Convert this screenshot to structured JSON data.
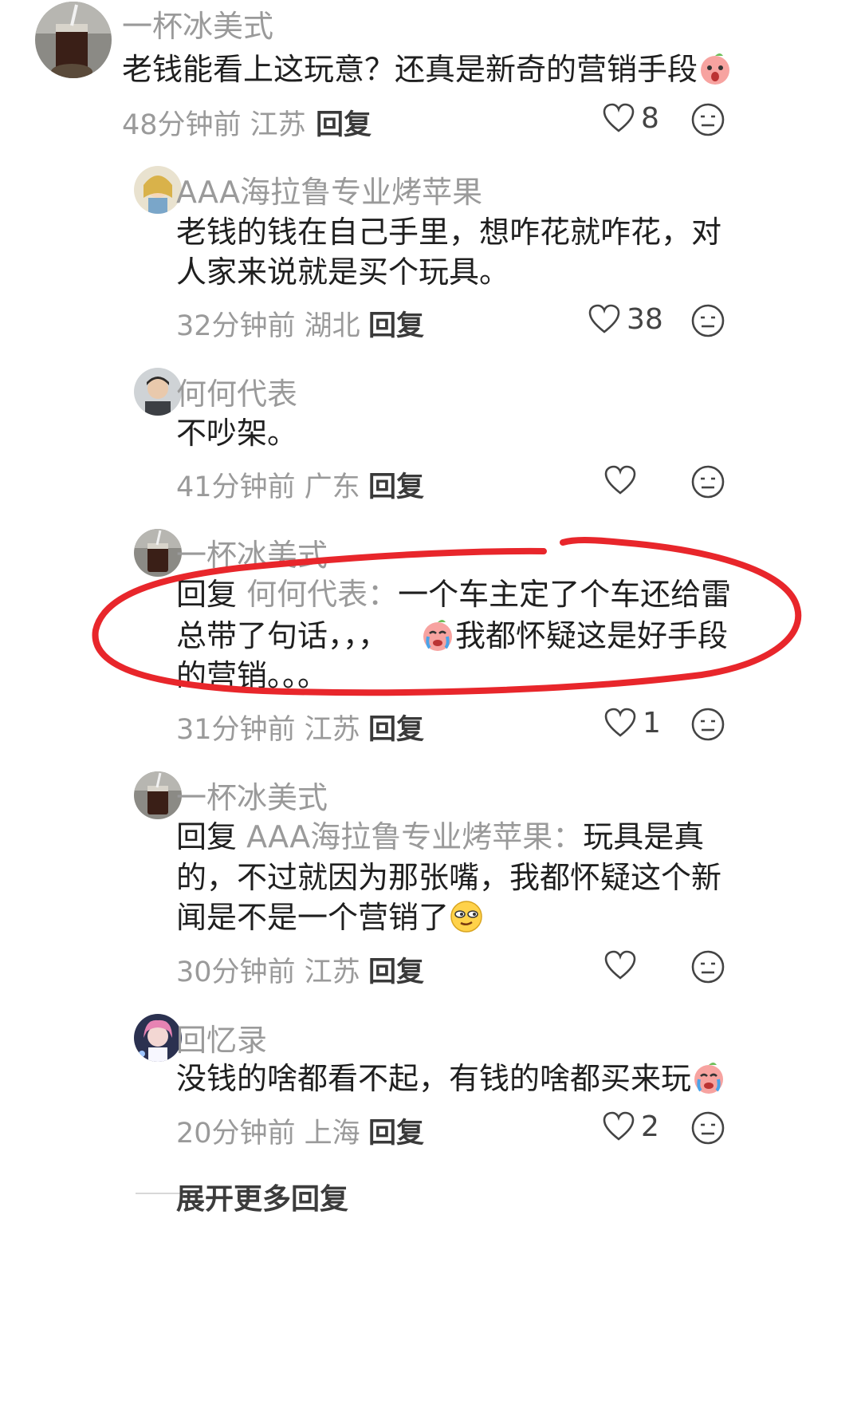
{
  "comments": [
    {
      "username": "一杯冰美式",
      "text": "老钱能看上这玩意？还真是新奇的营销手段",
      "time_location": "48分钟前 江苏",
      "reply_label": "回复",
      "likes": "8"
    }
  ],
  "replies": [
    {
      "username": "AAA海拉鲁专业烤苹果",
      "lines": [
        "老钱的钱在自己手里，想咋花就咋花，对",
        "人家来说就是买个玩具。"
      ],
      "time_location": "32分钟前 湖北",
      "reply_label": "回复",
      "likes": "38"
    },
    {
      "username": "何何代表",
      "lines": [
        "不吵架。"
      ],
      "time_location": "41分钟前 广东",
      "reply_label": "回复",
      "likes": ""
    },
    {
      "username": "一杯冰美式",
      "reply_prefix": "回复",
      "reply_to": "何何代表：",
      "lines": [
        "一个车主定了个车还给雷",
        "总带了句话，，，",
        "我都怀疑这是好手段",
        "的营销。。。"
      ],
      "time_location": "31分钟前 江苏",
      "reply_label": "回复",
      "likes": "1"
    },
    {
      "username": "一杯冰美式",
      "reply_prefix": "回复",
      "reply_to": "AAA海拉鲁专业烤苹果：",
      "lines": [
        "玩具是真",
        "的，不过就因为那张嘴，我都怀疑这个新",
        "闻是不是一个营销了"
      ],
      "time_location": "30分钟前 江苏",
      "reply_label": "回复",
      "likes": ""
    },
    {
      "username": "回忆录",
      "lines": [
        "没钱的啥都看不起，有钱的啥都买来玩"
      ],
      "time_location": "20分钟前 上海",
      "reply_label": "回复",
      "likes": "2"
    }
  ],
  "expand_more": "展开更多回复",
  "colors": {
    "annotation_circle": "#e8262b",
    "meta_gray": "#9a9a9a",
    "text": "#1f1f1f"
  },
  "icons": {
    "like": "heart-outline-icon",
    "react": "neutral-face-icon"
  }
}
